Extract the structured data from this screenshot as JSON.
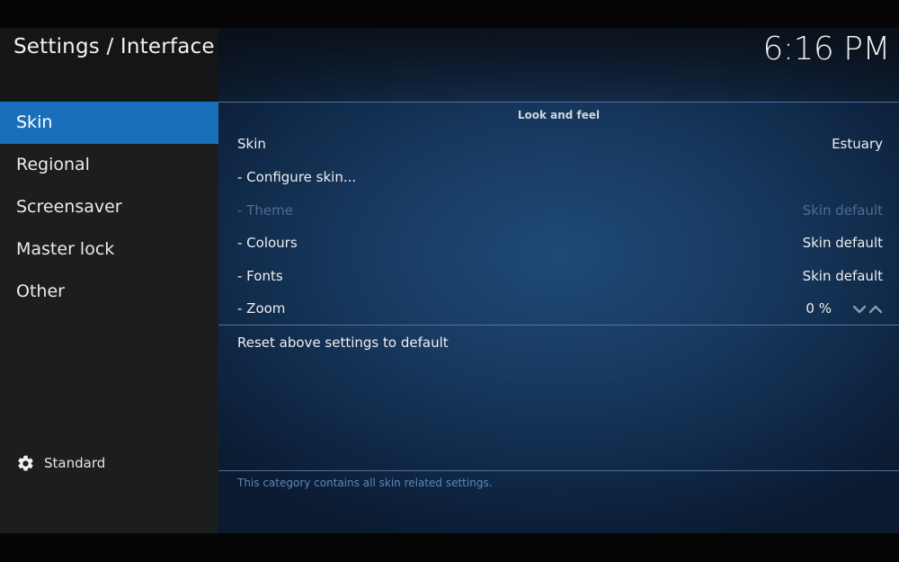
{
  "header": {
    "title": "Settings / Interface",
    "clock": "6:16 PM"
  },
  "sidebar": {
    "items": [
      {
        "label": "Skin",
        "active": true
      },
      {
        "label": "Regional",
        "active": false
      },
      {
        "label": "Screensaver",
        "active": false
      },
      {
        "label": "Master lock",
        "active": false
      },
      {
        "label": "Other",
        "active": false
      }
    ],
    "settings_level": {
      "icon": "gear-icon",
      "label": "Standard"
    }
  },
  "main": {
    "group_title": "Look and feel",
    "settings": [
      {
        "label": "Skin",
        "value": "Estuary",
        "enabled": true
      },
      {
        "label": "- Configure skin...",
        "value": "",
        "enabled": true
      },
      {
        "label": "- Theme",
        "value": "Skin default",
        "enabled": false
      },
      {
        "label": "- Colours",
        "value": "Skin default",
        "enabled": true
      },
      {
        "label": "- Fonts",
        "value": "Skin default",
        "enabled": true
      },
      {
        "label": "- Zoom",
        "value": "0 %",
        "enabled": true
      }
    ],
    "zoom_controls": {
      "decrease_icon": "chevron-down-icon",
      "increase_icon": "chevron-up-icon"
    },
    "reset_label": "Reset above settings to default",
    "description": "This category contains all skin related settings."
  },
  "colors": {
    "accent": "#1a6fbb",
    "sidebar_bg": "#1b1d1f",
    "panel_bg": "#183a61",
    "disabled_text": "#4f6d92",
    "description_text": "#5e87b8"
  }
}
